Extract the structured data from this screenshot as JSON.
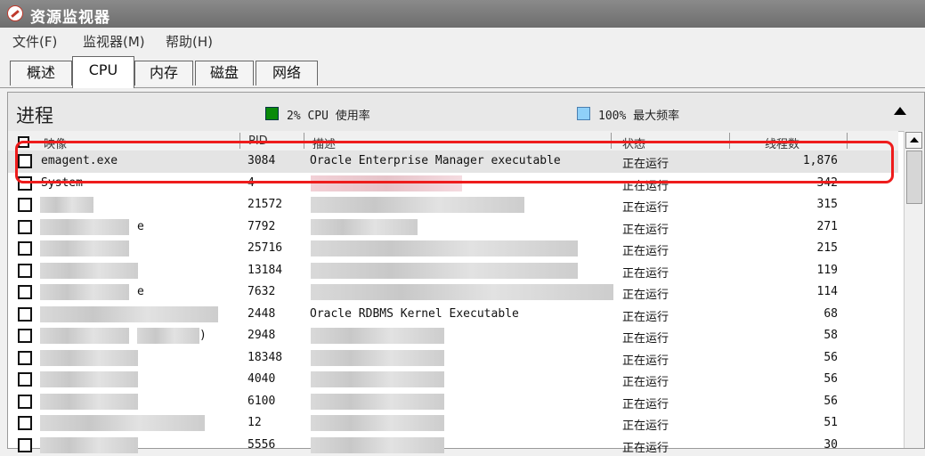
{
  "window": {
    "title": "资源监视器"
  },
  "menu": {
    "file": "文件(F)",
    "monitor": "监视器(M)",
    "help": "帮助(H)"
  },
  "tabs": [
    "概述",
    "CPU",
    "内存",
    "磁盘",
    "网络"
  ],
  "section": {
    "title": "进程",
    "cpu_usage": "2% CPU 使用率",
    "max_freq": "100% 最大频率"
  },
  "columns": {
    "image": "映像",
    "pid": "PID",
    "description": "描述",
    "status": "状态",
    "threads": "线程数"
  },
  "processes": [
    {
      "name": "emagent.exe",
      "pid": "3084",
      "description": "Oracle Enterprise Manager executable",
      "status": "正在运行",
      "threads": "1,876"
    },
    {
      "name": "System",
      "pid": "4",
      "description": "",
      "status": "正在运行",
      "threads": "342"
    },
    {
      "name": "",
      "pid": "21572",
      "description": "",
      "status": "正在运行",
      "threads": "315"
    },
    {
      "name": "e",
      "pid": "7792",
      "description": "",
      "status": "正在运行",
      "threads": "271"
    },
    {
      "name": "",
      "pid": "25716",
      "description": "",
      "status": "正在运行",
      "threads": "215"
    },
    {
      "name": "",
      "pid": "13184",
      "description": "",
      "status": "正在运行",
      "threads": "119"
    },
    {
      "name": "e",
      "pid": "7632",
      "description": "",
      "status": "正在运行",
      "threads": "114"
    },
    {
      "name": "",
      "pid": "2448",
      "description": "Oracle RDBMS Kernel Executable",
      "status": "正在运行",
      "threads": "68"
    },
    {
      "name": ")",
      "pid": "2948",
      "description": "",
      "status": "正在运行",
      "threads": "58"
    },
    {
      "name": "",
      "pid": "18348",
      "description": "",
      "status": "正在运行",
      "threads": "56"
    },
    {
      "name": "",
      "pid": "4040",
      "description": "",
      "status": "正在运行",
      "threads": "56"
    },
    {
      "name": "",
      "pid": "6100",
      "description": "",
      "status": "正在运行",
      "threads": "56"
    },
    {
      "name": "",
      "pid": "12",
      "description": "",
      "status": "正在运行",
      "threads": "51"
    },
    {
      "name": "",
      "pid": "5556",
      "description": "",
      "status": "正在运行",
      "threads": "30"
    }
  ],
  "colors": {
    "highlight": "#ee1c1c",
    "cpu_swatch": "#0a8a0a",
    "freq_swatch": "#8fd0f8"
  }
}
